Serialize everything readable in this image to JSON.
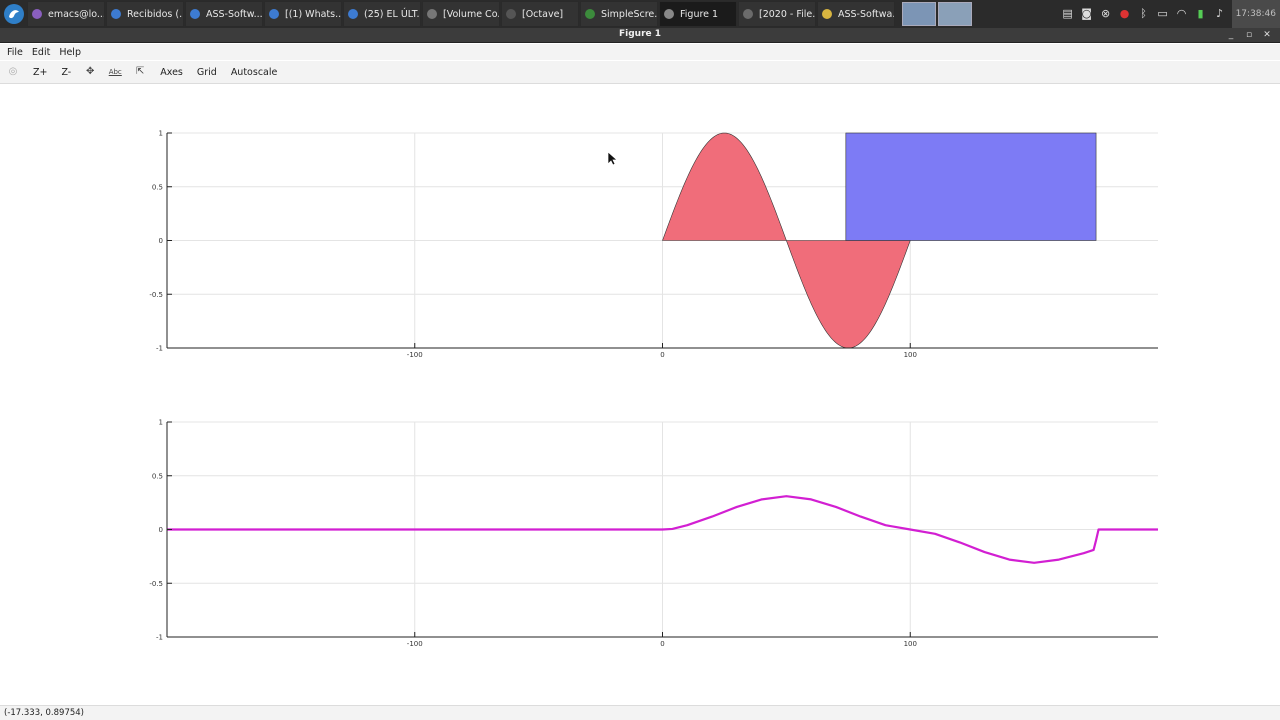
{
  "taskbar": {
    "tasks": [
      {
        "label": "emacs@lo...",
        "icon": "emacs-icon",
        "color": "#8a5fbf"
      },
      {
        "label": "Recibidos (...",
        "icon": "firefox-icon",
        "color": "#3d7bd1"
      },
      {
        "label": "ASS-Softw...",
        "icon": "firefox-icon",
        "color": "#3d7bd1"
      },
      {
        "label": "[(1) Whats...",
        "icon": "firefox-icon",
        "color": "#3d7bd1"
      },
      {
        "label": "(25) EL ÚLT...",
        "icon": "firefox-icon",
        "color": "#3d7bd1"
      },
      {
        "label": "[Volume Co...",
        "icon": "volume-icon",
        "color": "#777777"
      },
      {
        "label": "[Octave]",
        "icon": "octave-icon",
        "color": "#555555"
      },
      {
        "label": "SimpleScre...",
        "icon": "simplescreenrecorder-icon",
        "color": "#3c8b3c"
      },
      {
        "label": "Figure 1",
        "icon": "octave-icon",
        "color": "#888888"
      },
      {
        "label": "[2020 - File...",
        "icon": "folder-icon",
        "color": "#6b6b6b"
      },
      {
        "label": "ASS-Softwa...",
        "icon": "folder-icon",
        "color": "#d8b540"
      }
    ],
    "active_index": 8,
    "clock": "17:38:46"
  },
  "window": {
    "title": "Figure 1",
    "minimize": "_",
    "maximize": "▫",
    "close": "✕"
  },
  "menu": [
    "File",
    "Edit",
    "Help"
  ],
  "toolbar": {
    "zoom_in": "Z+",
    "zoom_out": "Z-",
    "axes": "Axes",
    "grid": "Grid",
    "autoscale": "Autoscale",
    "text_tool": "Abc"
  },
  "status": {
    "coords": "(-17.333, 0.89754)"
  },
  "chart_data": [
    {
      "type": "area",
      "xlim": [
        -200,
        200
      ],
      "ylim": [
        -1,
        1
      ],
      "xticks": [
        -100,
        0,
        100
      ],
      "yticks": [
        -1,
        -0.5,
        0,
        0.5,
        1
      ],
      "xtick_labels": [
        "-100",
        "0",
        "100"
      ],
      "ytick_labels": [
        "-1",
        "-0.5",
        "0",
        "0.5",
        "1"
      ],
      "grid": true,
      "series": [
        {
          "color": "#f06d7a",
          "kind": "sine-fill",
          "x": [
            0,
            100
          ],
          "amplitude": 1,
          "period": 100
        },
        {
          "color": "#7d7bf5",
          "kind": "rect-fill",
          "x": [
            74,
            175
          ],
          "y": [
            0,
            1
          ]
        }
      ]
    },
    {
      "type": "line",
      "xlim": [
        -200,
        200
      ],
      "ylim": [
        -1,
        1
      ],
      "xticks": [
        -100,
        0,
        100
      ],
      "yticks": [
        -1,
        -0.5,
        0,
        0.5,
        1
      ],
      "xtick_labels": [
        "-100",
        "0",
        "100"
      ],
      "ytick_labels": [
        "-1",
        "-0.5",
        "0",
        "0.5",
        "1"
      ],
      "grid": true,
      "series": [
        {
          "color": "#d21fd2",
          "x": [
            -200,
            0,
            4,
            10,
            20,
            30,
            40,
            50,
            60,
            70,
            80,
            90,
            100,
            110,
            120,
            130,
            140,
            150,
            160,
            170,
            174,
            175,
            176,
            200
          ],
          "y": [
            0,
            0,
            0.005,
            0.04,
            0.12,
            0.21,
            0.28,
            0.31,
            0.28,
            0.21,
            0.12,
            0.04,
            0.0,
            -0.04,
            -0.12,
            -0.21,
            -0.28,
            -0.31,
            -0.28,
            -0.22,
            -0.19,
            -0.1,
            0,
            0
          ]
        }
      ]
    }
  ]
}
